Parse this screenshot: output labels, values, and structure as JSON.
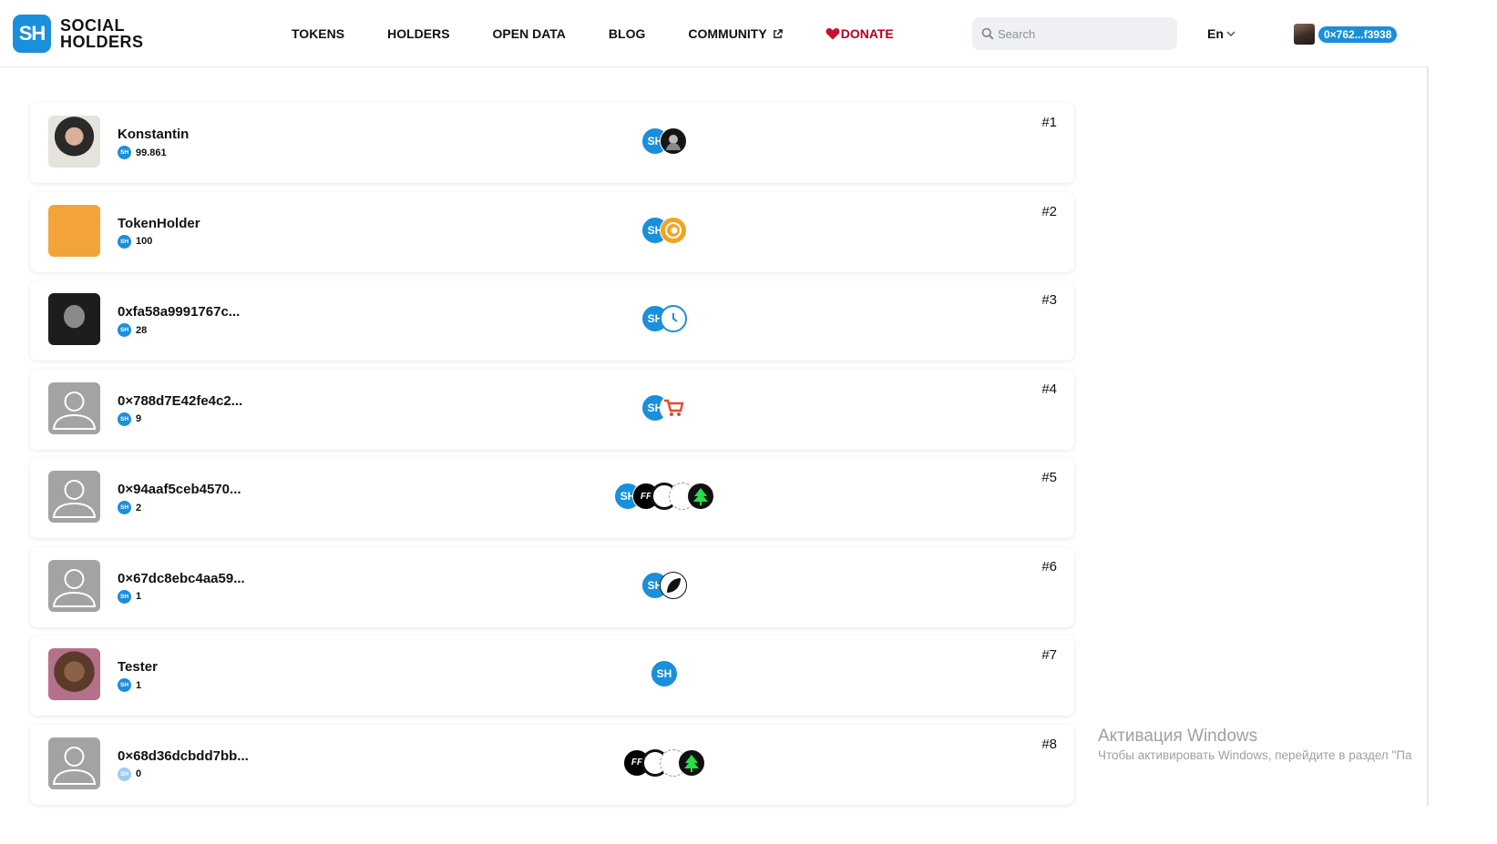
{
  "header": {
    "logo_mark": "SH",
    "logo_line1": "SOCIAL",
    "logo_line2": "HOLDERS",
    "nav": {
      "tokens": "TOKENS",
      "holders": "HOLDERS",
      "open_data": "OPEN DATA",
      "blog": "BLOG",
      "community": "COMMUNITY",
      "donate": "DONATE"
    },
    "search_placeholder": "Search",
    "language": "En",
    "wallet_address": "0×762...f3938"
  },
  "holders": [
    {
      "name": "Konstantin",
      "balance": "99.861",
      "rank": "#1",
      "avatar": "photo",
      "tokens": [
        "sh",
        "dark"
      ]
    },
    {
      "name": "TokenHolder",
      "balance": "100",
      "rank": "#2",
      "avatar": "ape",
      "tokens": [
        "sh",
        "lion"
      ]
    },
    {
      "name": "0xfa58a9991767c...",
      "balance": "28",
      "rank": "#3",
      "avatar": "photo-back",
      "tokens": [
        "sh",
        "clock"
      ]
    },
    {
      "name": "0×788d7E42fe4c2...",
      "balance": "9",
      "rank": "#4",
      "avatar": "default",
      "tokens": [
        "sh",
        "cart"
      ]
    },
    {
      "name": "0×94aaf5ceb4570...",
      "balance": "2",
      "rank": "#5",
      "avatar": "default",
      "tokens": [
        "sh",
        "ff",
        "swirl",
        "spider",
        "tree"
      ]
    },
    {
      "name": "0×67dc8ebc4aa59...",
      "balance": "1",
      "rank": "#6",
      "avatar": "default",
      "tokens": [
        "sh",
        "leaf"
      ]
    },
    {
      "name": "Tester",
      "balance": "1",
      "rank": "#7",
      "avatar": "photo",
      "tokens": [
        "sh"
      ]
    },
    {
      "name": "0×68d36dcbdd7bb...",
      "balance": "0",
      "rank": "#8",
      "avatar": "default",
      "tokens": [
        "ff",
        "swirl",
        "spider",
        "tree"
      ]
    }
  ],
  "token_mini_label": "SH",
  "watermark": {
    "title": "Активация Windows",
    "subtitle": "Чтобы активировать Windows, перейдите в раздел \"Па"
  },
  "colors": {
    "accent": "#1a8fdc",
    "donate": "#b40018",
    "card_shadow": "#e4e4e4"
  }
}
